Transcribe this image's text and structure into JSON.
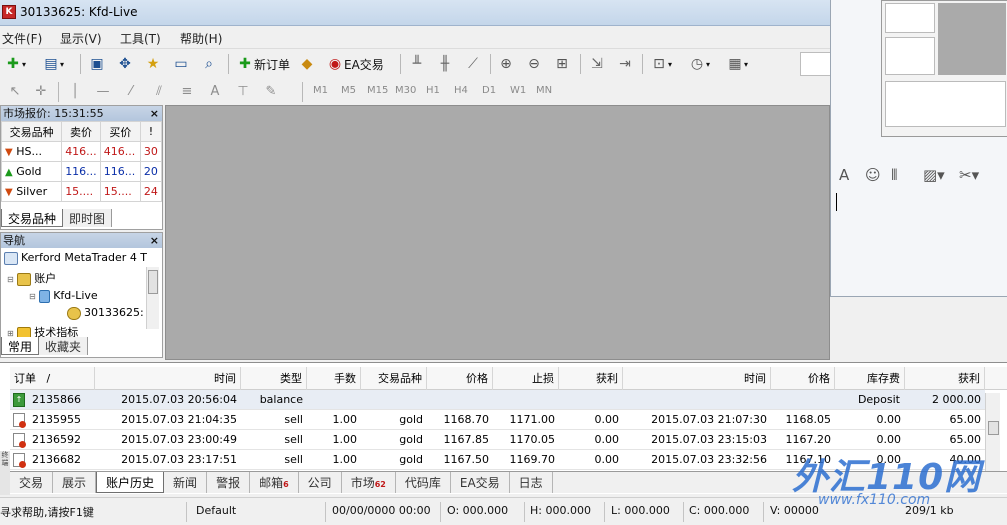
{
  "window": {
    "title": "30133625: Kfd-Live",
    "app_icon_letter": "K"
  },
  "menu": [
    {
      "label": "文件(F)"
    },
    {
      "label": "显示(V)"
    },
    {
      "label": "工具(T)"
    },
    {
      "label": "帮助(H)"
    }
  ],
  "toolbar1": {
    "new_order_label": "新订单",
    "ea_trade_label": "EA交易"
  },
  "toolbar2": {
    "text_tool": "A",
    "timeframes": [
      "M1",
      "M5",
      "M15",
      "M30",
      "H1",
      "H4",
      "D1",
      "W1",
      "MN"
    ]
  },
  "market_watch": {
    "title": "市场报价: 15:31:55",
    "headers": {
      "symbol": "交易品种",
      "bid": "卖价",
      "ask": "买价",
      "spread": "!"
    },
    "rows": [
      {
        "direction": "down",
        "symbol": "HS...",
        "bid": "416...",
        "ask": "416...",
        "spread": "30"
      },
      {
        "direction": "up",
        "symbol": "Gold",
        "bid": "116...",
        "ask": "116...",
        "spread": "20"
      },
      {
        "direction": "down",
        "symbol": "Silver",
        "bid": "15....",
        "ask": "15....",
        "spread": "24"
      }
    ],
    "tabs": [
      "交易品种",
      "即时图"
    ]
  },
  "navigator": {
    "title": "导航",
    "root": "Kerford MetaTrader 4 T",
    "accounts": "账户",
    "server": "Kfd-Live",
    "account_number": "30133625:",
    "indicators": "技术指标",
    "tabs": [
      "常用",
      "收藏夹"
    ]
  },
  "terminal": {
    "headers": {
      "order": "订单",
      "sort_mark": "/",
      "open_time": "时间",
      "type": "类型",
      "lots": "手数",
      "symbol": "交易品种",
      "open_price": "价格",
      "sl": "止损",
      "tp": "获利",
      "close_time": "时间",
      "close_price": "价格",
      "swap": "库存费",
      "profit": "获利"
    },
    "rows": [
      {
        "order": "2135866",
        "open_time": "2015.07.03 20:56:04",
        "type": "balance",
        "lots": "",
        "symbol": "",
        "open_price": "",
        "sl": "",
        "tp": "",
        "close_time": "",
        "close_price": "",
        "swap": "Deposit",
        "profit": "2 000.00"
      },
      {
        "order": "2135955",
        "open_time": "2015.07.03 21:04:35",
        "type": "sell",
        "lots": "1.00",
        "symbol": "gold",
        "open_price": "1168.70",
        "sl": "1171.00",
        "tp": "0.00",
        "close_time": "2015.07.03 21:07:30",
        "close_price": "1168.05",
        "swap": "0.00",
        "profit": "65.00"
      },
      {
        "order": "2136592",
        "open_time": "2015.07.03 23:00:49",
        "type": "sell",
        "lots": "1.00",
        "symbol": "gold",
        "open_price": "1167.85",
        "sl": "1170.05",
        "tp": "0.00",
        "close_time": "2015.07.03 23:15:03",
        "close_price": "1167.20",
        "swap": "0.00",
        "profit": "65.00"
      },
      {
        "order": "2136682",
        "open_time": "2015.07.03 23:17:51",
        "type": "sell",
        "lots": "1.00",
        "symbol": "gold",
        "open_price": "1167.50",
        "sl": "1169.70",
        "tp": "0.00",
        "close_time": "2015.07.03 23:32:56",
        "close_price": "1167.10",
        "swap": "0.00",
        "profit": "40.00"
      }
    ],
    "side_label": "终端",
    "tabs": [
      {
        "label": "交易",
        "badge": ""
      },
      {
        "label": "展示",
        "badge": ""
      },
      {
        "label": "账户历史",
        "badge": ""
      },
      {
        "label": "新闻",
        "badge": ""
      },
      {
        "label": "警报",
        "badge": ""
      },
      {
        "label": "邮箱",
        "badge": "6"
      },
      {
        "label": "公司",
        "badge": ""
      },
      {
        "label": "市场",
        "badge": "62"
      },
      {
        "label": "代码库",
        "badge": ""
      },
      {
        "label": "EA交易",
        "badge": ""
      },
      {
        "label": "日志",
        "badge": ""
      }
    ],
    "active_tab": 2
  },
  "statusbar": {
    "help": "寻求帮助,请按F1键",
    "profile": "Default",
    "datetime": "00/00/0000 00:00",
    "open": "O: 000.000",
    "high": "H: 000.000",
    "low": "L: 000.000",
    "close": "C: 000.000",
    "volume": "V: 00000",
    "traffic": "209/1 kb"
  },
  "watermark": {
    "big": "外汇110网",
    "small": "www.fx110.com"
  },
  "colors": {
    "sell_price": "#c01818",
    "buy_price": "#0a2fa8",
    "chart_bg": "#aaaaaa",
    "watermark": "#2d6fd1"
  }
}
